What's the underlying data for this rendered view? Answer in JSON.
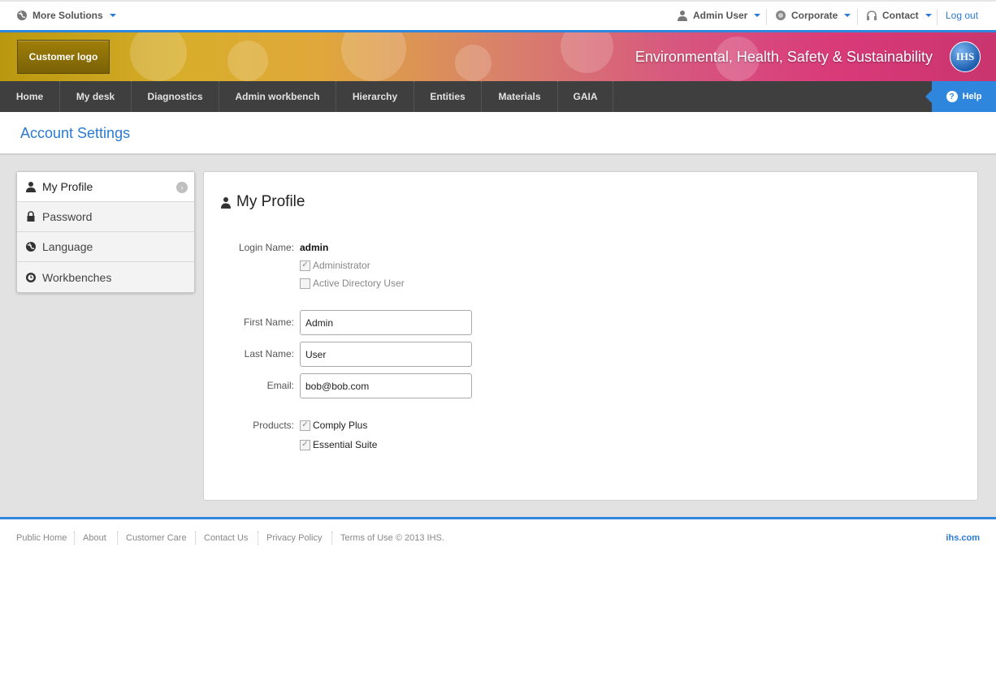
{
  "topbar": {
    "more_solutions": "More Solutions",
    "user": "Admin User",
    "org": "Corporate",
    "contact": "Contact",
    "logout": "Log out"
  },
  "banner": {
    "customer_logo": "Customer logo",
    "title": "Environmental, Health, Safety & Sustainability",
    "brand": "IHS"
  },
  "nav": {
    "items": [
      "Home",
      "My desk",
      "Diagnostics",
      "Admin workbench",
      "Hierarchy",
      "Entities",
      "Materials",
      "GAIA"
    ],
    "help": "Help"
  },
  "page": {
    "title": "Account Settings"
  },
  "sidebar": {
    "items": [
      {
        "label": "My Profile",
        "icon": "user-icon"
      },
      {
        "label": "Password",
        "icon": "lock-icon"
      },
      {
        "label": "Language",
        "icon": "globe-icon"
      },
      {
        "label": "Workbenches",
        "icon": "workbench-icon"
      }
    ]
  },
  "profile": {
    "title": "My Profile",
    "login_label": "Login Name:",
    "login_value": "admin",
    "administrator": {
      "label": "Administrator",
      "checked": true,
      "disabled": true
    },
    "ad_user": {
      "label": "Active Directory User",
      "checked": false,
      "disabled": true
    },
    "first_name_label": "First Name:",
    "first_name": "Admin",
    "last_name_label": "Last Name:",
    "last_name": "User",
    "email_label": "Email:",
    "email": "bob@bob.com",
    "products_label": "Products:",
    "products": [
      {
        "label": "Comply Plus",
        "checked": true
      },
      {
        "label": "Essential Suite",
        "checked": true
      }
    ]
  },
  "footer": {
    "links": [
      "Public Home",
      "About",
      "Customer Care",
      "Contact Us",
      "Privacy Policy"
    ],
    "copyright": "Terms of Use © 2013 IHS.",
    "site": "ihs.com"
  },
  "colors": {
    "accent": "#2f86dd",
    "nav_bg": "#3f3f3f",
    "link": "#2a7ad3"
  }
}
